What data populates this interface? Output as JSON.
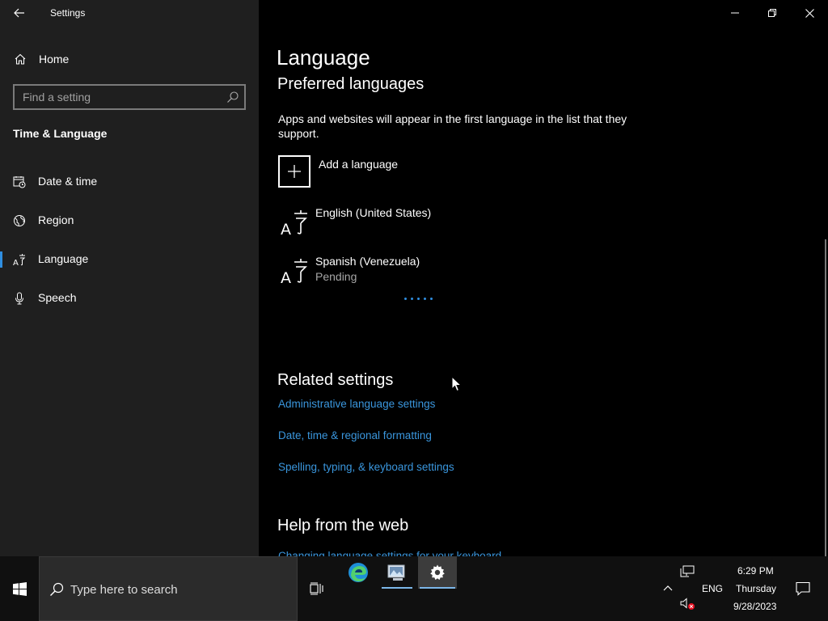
{
  "window": {
    "title": "Settings"
  },
  "sidebar": {
    "home_label": "Home",
    "search_placeholder": "Find a setting",
    "section_title": "Time & Language",
    "items": [
      {
        "label": "Date & time",
        "icon": "calendar-clock-icon"
      },
      {
        "label": "Region",
        "icon": "globe-icon"
      },
      {
        "label": "Language",
        "icon": "language-icon",
        "active": true
      },
      {
        "label": "Speech",
        "icon": "microphone-icon"
      }
    ]
  },
  "main": {
    "page_title": "Language",
    "preferred_heading": "Preferred languages",
    "preferred_description": "Apps and websites will appear in the first language in the list that they support.",
    "add_language_label": "Add a language",
    "languages": [
      {
        "name": "English (United States)",
        "status": ""
      },
      {
        "name": "Spanish (Venezuela)",
        "status": "Pending"
      }
    ],
    "related_heading": "Related settings",
    "related_links": [
      "Administrative language settings",
      "Date, time & regional formatting",
      "Spelling, typing, & keyboard settings"
    ],
    "help_heading": "Help from the web",
    "help_link_partial": "Changing language settings for your keyboard"
  },
  "taskbar": {
    "search_placeholder": "Type here to search",
    "tray": {
      "lang": "ENG",
      "time": "6:29 PM",
      "day": "Thursday",
      "date": "9/28/2023"
    }
  },
  "colors": {
    "accent": "#2f8ee0",
    "link": "#3a96dd",
    "sidebar_bg": "#1f1f1f",
    "main_bg": "#000000",
    "taskbar_bg": "#101010"
  }
}
